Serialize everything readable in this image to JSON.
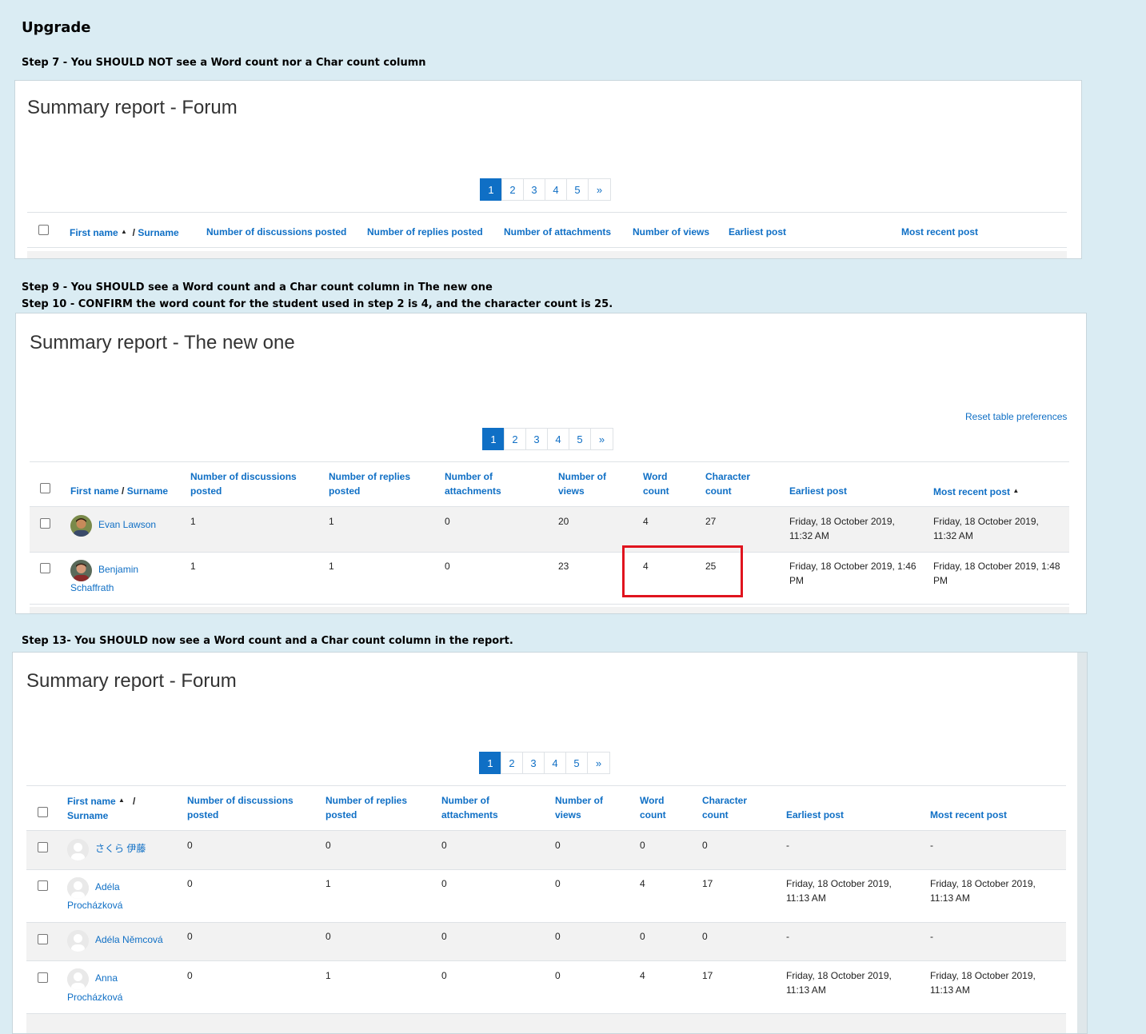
{
  "heading": "Upgrade",
  "notes": {
    "step7": "Step 7 - You SHOULD NOT see a Word count nor a Char count column",
    "step9": "Step 9 - You SHOULD see a Word count and a Char count column in The new one",
    "step10": "Step 10 - CONFIRM the word count for the student used in step 2 is 4, and the character count is 25.",
    "step13": "Step 13- You SHOULD now see a Word count and a Char count column in the report."
  },
  "pager": {
    "pages": [
      "1",
      "2",
      "3",
      "4",
      "5"
    ],
    "next": "»",
    "active": "1"
  },
  "shot1": {
    "title": "Summary report - Forum",
    "headers": {
      "first_name": "First name",
      "sep": "/",
      "surname": "Surname",
      "discussions": "Number of discussions posted",
      "replies": "Number of replies posted",
      "attachments": "Number of attachments",
      "views": "Number of views",
      "earliest": "Earliest post",
      "recent": "Most recent post"
    }
  },
  "shot2": {
    "title": "Summary report - The new one",
    "reset_link": "Reset table preferences",
    "headers": {
      "first_name": "First name",
      "sep": "/",
      "surname": "Surname",
      "discussions_1": "Number of discussions",
      "discussions_2": "posted",
      "replies_1": "Number of replies",
      "replies_2": "posted",
      "attachments_1": "Number of",
      "attachments_2": "attachments",
      "views_1": "Number of",
      "views_2": "views",
      "word_1": "Word",
      "word_2": "count",
      "char_1": "Character",
      "char_2": "count",
      "earliest": "Earliest post",
      "recent": "Most recent post"
    },
    "rows": [
      {
        "name_1": "Evan Lawson",
        "name_2": "",
        "discussions": "1",
        "replies": "1",
        "attachments": "0",
        "views": "20",
        "word": "4",
        "char": "27",
        "earliest_1": "Friday, 18 October 2019,",
        "earliest_2": "11:32 AM",
        "recent_1": "Friday, 18 October 2019,",
        "recent_2": "11:32 AM"
      },
      {
        "name_1": "Benjamin",
        "name_2": "Schaffrath",
        "discussions": "1",
        "replies": "1",
        "attachments": "0",
        "views": "23",
        "word": "4",
        "char": "25",
        "earliest_1": "Friday, 18 October 2019, 1:46",
        "earliest_2": "PM",
        "recent_1": "Friday, 18 October 2019, 1:48",
        "recent_2": "PM"
      }
    ]
  },
  "shot3": {
    "title": "Summary report - Forum",
    "headers": {
      "first_name": "First name",
      "sep": "/",
      "surname": "Surname",
      "discussions_1": "Number of discussions",
      "discussions_2": "posted",
      "replies_1": "Number of replies",
      "replies_2": "posted",
      "attachments_1": "Number of",
      "attachments_2": "attachments",
      "views_1": "Number of",
      "views_2": "views",
      "word_1": "Word",
      "word_2": "count",
      "char_1": "Character",
      "char_2": "count",
      "earliest": "Earliest post",
      "recent": "Most recent post"
    },
    "rows": [
      {
        "name_1": "さくら 伊藤",
        "name_2": "",
        "discussions": "0",
        "replies": "0",
        "attachments": "0",
        "views": "0",
        "word": "0",
        "char": "0",
        "earliest_1": "-",
        "earliest_2": "",
        "recent_1": "-",
        "recent_2": ""
      },
      {
        "name_1": "Adéla",
        "name_2": "Procházková",
        "discussions": "0",
        "replies": "1",
        "attachments": "0",
        "views": "0",
        "word": "4",
        "char": "17",
        "earliest_1": "Friday, 18 October 2019,",
        "earliest_2": "11:13 AM",
        "recent_1": "Friday, 18 October 2019,",
        "recent_2": "11:13 AM"
      },
      {
        "name_1": "Adéla Němcová",
        "name_2": "",
        "discussions": "0",
        "replies": "0",
        "attachments": "0",
        "views": "0",
        "word": "0",
        "char": "0",
        "earliest_1": "-",
        "earliest_2": "",
        "recent_1": "-",
        "recent_2": ""
      },
      {
        "name_1": "Anna",
        "name_2": "Procházková",
        "discussions": "0",
        "replies": "1",
        "attachments": "0",
        "views": "0",
        "word": "4",
        "char": "17",
        "earliest_1": "Friday, 18 October 2019,",
        "earliest_2": "11:13 AM",
        "recent_1": "Friday, 18 October 2019,",
        "recent_2": "11:13 AM"
      }
    ]
  },
  "colors": {
    "background": "#daecf3",
    "link": "#0f6fc5",
    "highlight": "#e0141e",
    "row_band": "#f2f2f2"
  }
}
